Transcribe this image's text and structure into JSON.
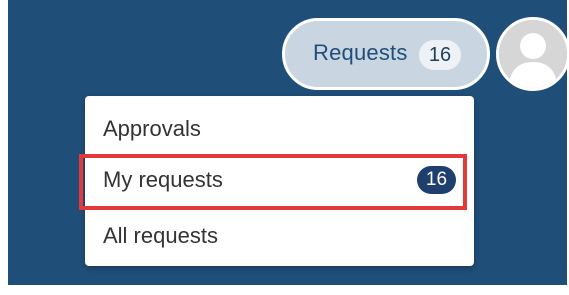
{
  "header": {
    "requests_button": {
      "label": "Requests",
      "count": "16"
    },
    "avatar_icon": "user-avatar-icon"
  },
  "dropdown": {
    "items": [
      {
        "label": "Approvals",
        "badge": ""
      },
      {
        "label": "My requests",
        "badge": "16",
        "highlighted": true
      },
      {
        "label": "All requests",
        "badge": ""
      }
    ]
  },
  "colors": {
    "navbar_bg": "#1f4e79",
    "button_bg": "#c9d6e2",
    "badge_bg": "#1f3f6f",
    "highlight": "#e23a3a"
  }
}
